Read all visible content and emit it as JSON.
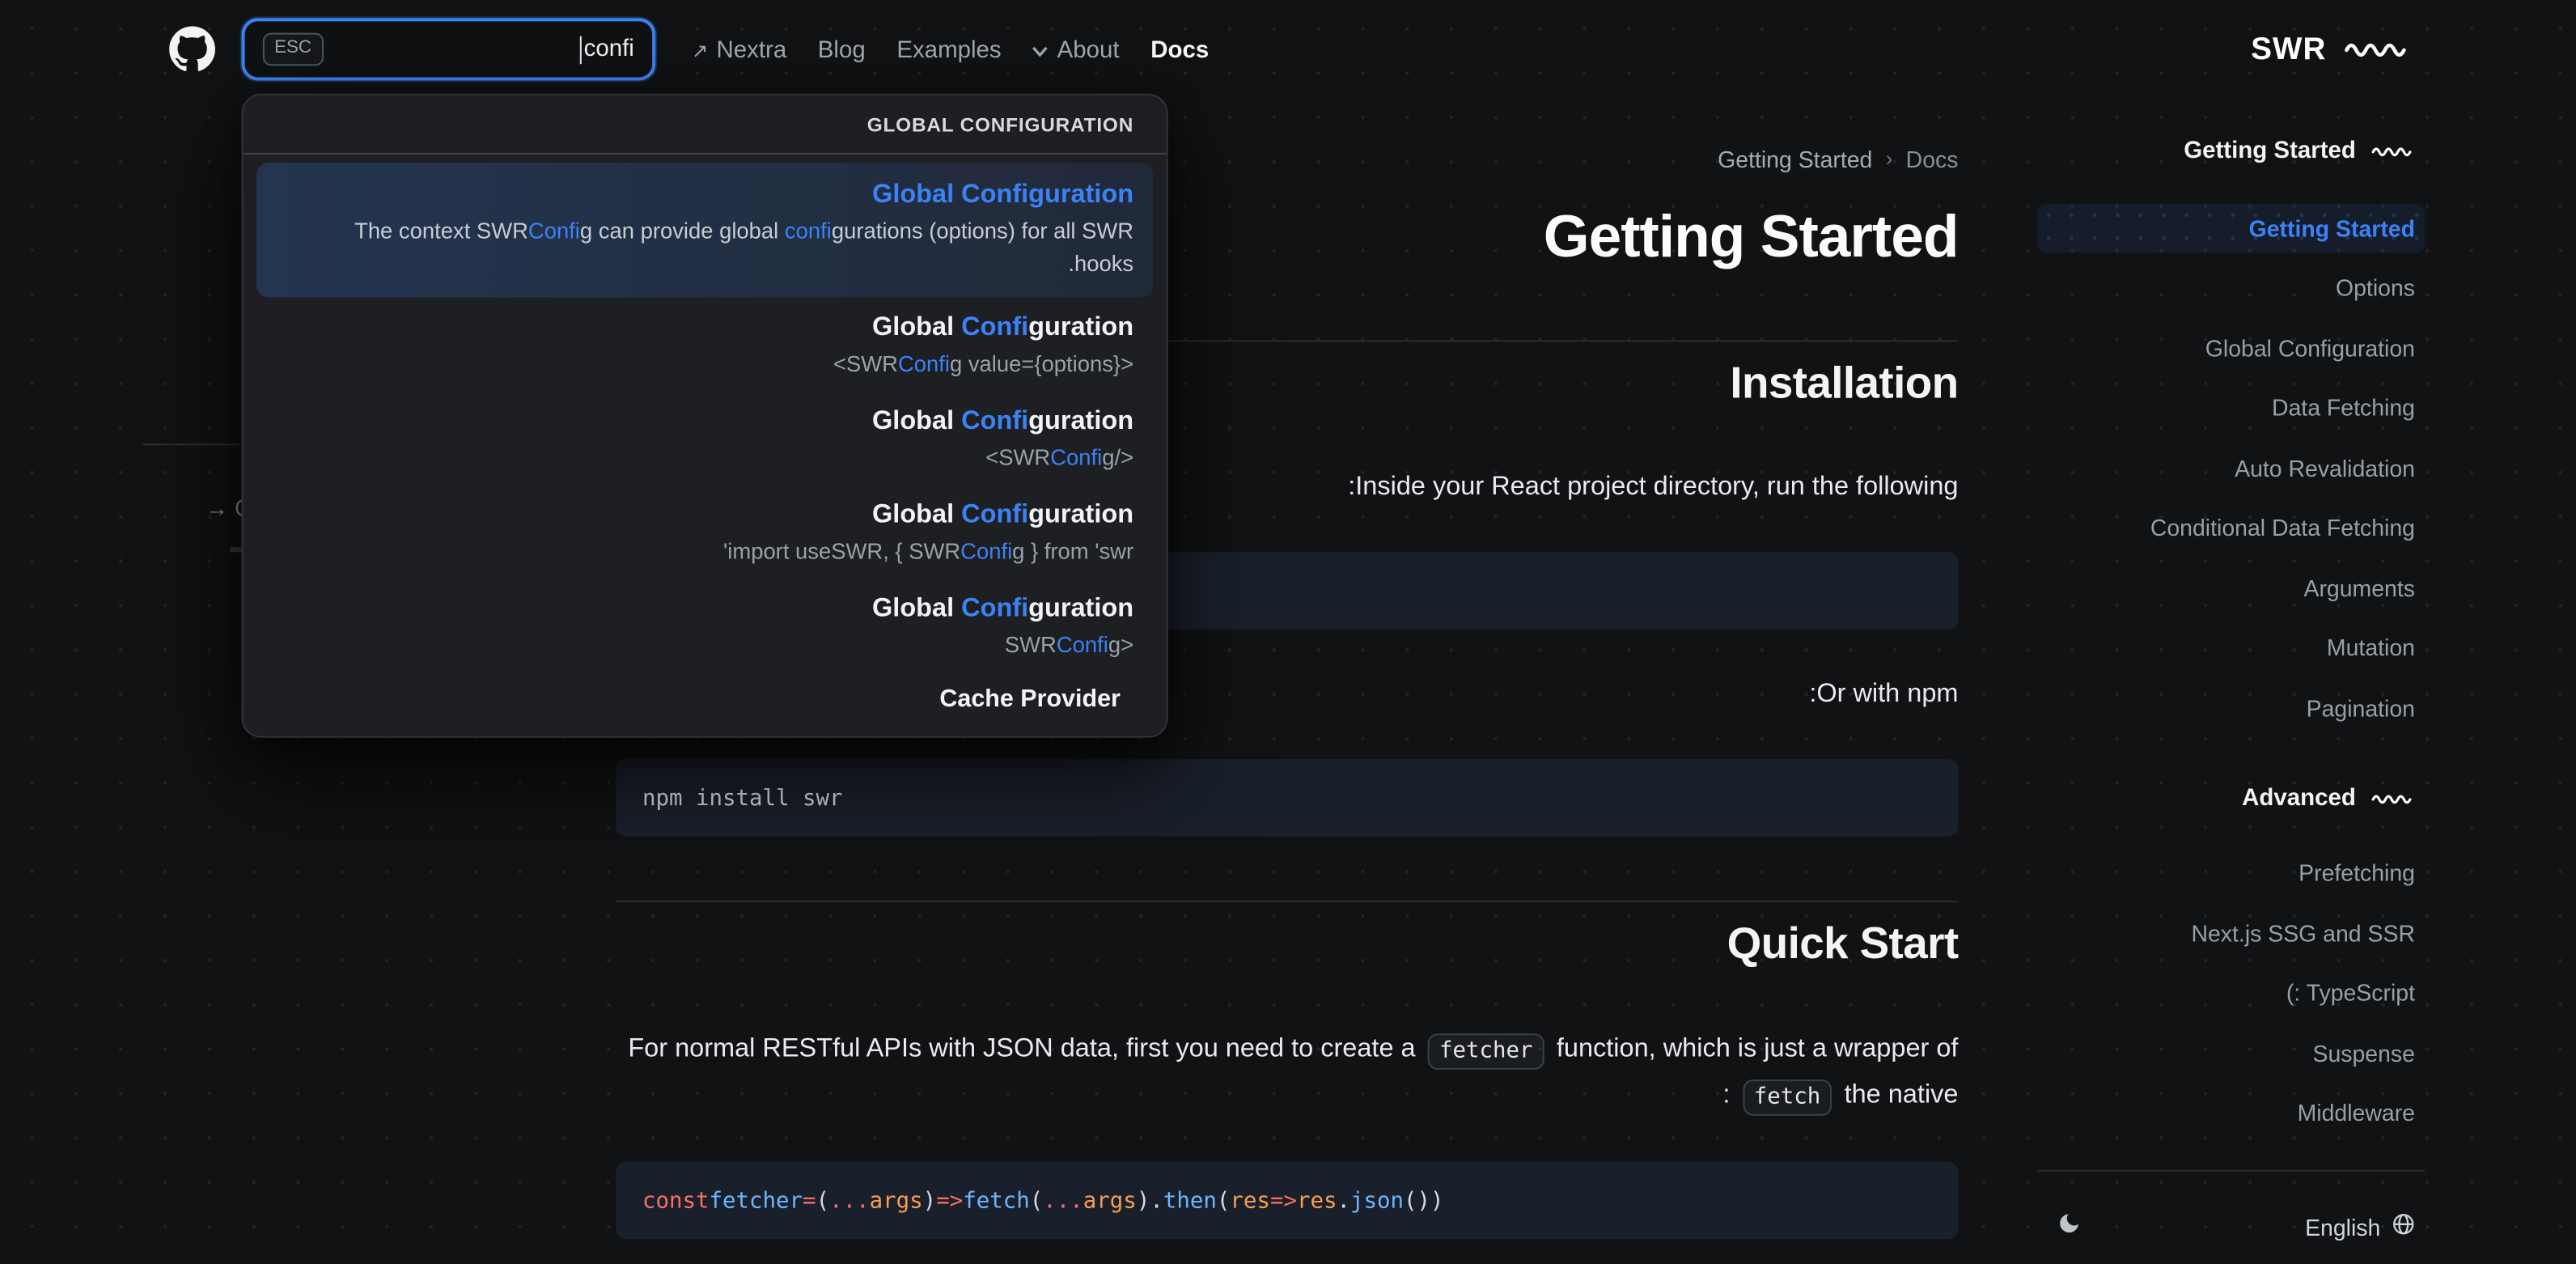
{
  "theme": {
    "accent": "#3b82f6",
    "background": "#111214",
    "code_block_bg": "#1a202b"
  },
  "navbar": {
    "search": {
      "esc": "ESC",
      "value": "confi"
    },
    "links": [
      {
        "label": "Nextra"
      },
      {
        "label": "Blog"
      },
      {
        "label": "Examples"
      },
      {
        "label": "About"
      },
      {
        "label": "Docs"
      }
    ],
    "logo_text": "SWR"
  },
  "search_dropdown": {
    "section_header": "GLOBAL CONFIGURATION",
    "selected": {
      "title": "Global Configuration",
      "desc_line1": [
        {
          "t": "The context SWR"
        },
        {
          "t": "Confi",
          "c": "hl"
        },
        {
          "t": "g can provide global "
        },
        {
          "t": "confi",
          "c": "hl"
        },
        {
          "t": "gurations (options) for all SWR"
        }
      ],
      "desc_line2": [
        {
          "t": ".hooks"
        }
      ]
    },
    "results": [
      {
        "title": [
          {
            "t": "Global "
          },
          {
            "t": "Confi",
            "c": "hl"
          },
          {
            "t": "guration"
          }
        ],
        "sub": [
          {
            "t": "<SWR"
          },
          {
            "t": "Confi",
            "c": "hl"
          },
          {
            "t": "g value={options}>"
          }
        ]
      },
      {
        "title": [
          {
            "t": "Global "
          },
          {
            "t": "Confi",
            "c": "hl"
          },
          {
            "t": "guration"
          }
        ],
        "sub": [
          {
            "t": "<SWR"
          },
          {
            "t": "Confi",
            "c": "hl"
          },
          {
            "t": "g/>"
          }
        ]
      },
      {
        "title": [
          {
            "t": "Global "
          },
          {
            "t": "Confi",
            "c": "hl"
          },
          {
            "t": "guration"
          }
        ],
        "sub": [
          {
            "t": "'import useSWR, { SWR"
          },
          {
            "t": "Confi",
            "c": "hl"
          },
          {
            "t": "g } from 'swr"
          }
        ]
      },
      {
        "title": [
          {
            "t": "Global "
          },
          {
            "t": "Confi",
            "c": "hl"
          },
          {
            "t": "guration"
          }
        ],
        "sub": [
          {
            "t": "SWR"
          },
          {
            "t": "Confi",
            "c": "hl"
          },
          {
            "t": "g>"
          }
        ]
      }
    ],
    "footer_header": "Cache Provider"
  },
  "main": {
    "breadcrumb": {
      "parent": "Getting Started",
      "separator": "›",
      "current": "Docs"
    },
    "page_title": "Getting Started",
    "installation": {
      "heading": "Installation",
      "para": ":Inside your React project directory, run the following",
      "code": "",
      "para2": ":Or with npm",
      "code2": "npm install swr"
    },
    "quick_start": {
      "heading": "Quick Start",
      "para_line1": [
        {
          "t": "For normal RESTful APIs with JSON data, first you need to create a "
        },
        {
          "t": "fetcher",
          "c": "code"
        },
        {
          "t": " function, which is just a wrapper of"
        }
      ],
      "para_line2": [
        {
          "t": ": "
        },
        {
          "t": "fetch",
          "c": "code"
        },
        {
          "t": " the native"
        }
      ],
      "code_tokens": [
        {
          "t": "const",
          "c": "red"
        },
        {
          "t": " "
        },
        {
          "t": "fetcher",
          "c": "blue"
        },
        {
          "t": " "
        },
        {
          "t": "=",
          "c": "red"
        },
        {
          "t": " ("
        },
        {
          "t": "...",
          "c": "red"
        },
        {
          "t": "args",
          "c": "orange"
        },
        {
          "t": ") "
        },
        {
          "t": "=>",
          "c": "red"
        },
        {
          "t": " "
        },
        {
          "t": "fetch",
          "c": "blue"
        },
        {
          "t": "("
        },
        {
          "t": "...",
          "c": "red"
        },
        {
          "t": "args",
          "c": "orange"
        },
        {
          "t": ")."
        },
        {
          "t": "then",
          "c": "blue"
        },
        {
          "t": "("
        },
        {
          "t": "res",
          "c": "orange"
        },
        {
          "t": " "
        },
        {
          "t": "=>",
          "c": "red"
        },
        {
          "t": " "
        },
        {
          "t": "res",
          "c": "orange"
        },
        {
          "t": "."
        },
        {
          "t": "json",
          "c": "blue"
        },
        {
          "t": "())"
        }
      ]
    }
  },
  "left_fragment": {
    "label": "→ Q"
  },
  "sidebar": {
    "sections": [
      {
        "header": "Getting Started",
        "active_item": "Getting Started",
        "items": [
          {
            "label": "Options"
          },
          {
            "label": "Global Configuration"
          },
          {
            "label": "Data Fetching"
          },
          {
            "label": "Auto Revalidation"
          },
          {
            "label": "Conditional Data Fetching"
          },
          {
            "label": "Arguments"
          },
          {
            "label": "Mutation"
          },
          {
            "label": "Pagination"
          }
        ]
      },
      {
        "header": "Advanced",
        "items": [
          {
            "label": "Prefetching"
          },
          {
            "label": "Next.js SSG and SSR"
          },
          {
            "label": "(: TypeScript"
          },
          {
            "label": "Suspense"
          },
          {
            "label": "Middleware"
          }
        ]
      }
    ],
    "footer": {
      "language": "English"
    }
  }
}
